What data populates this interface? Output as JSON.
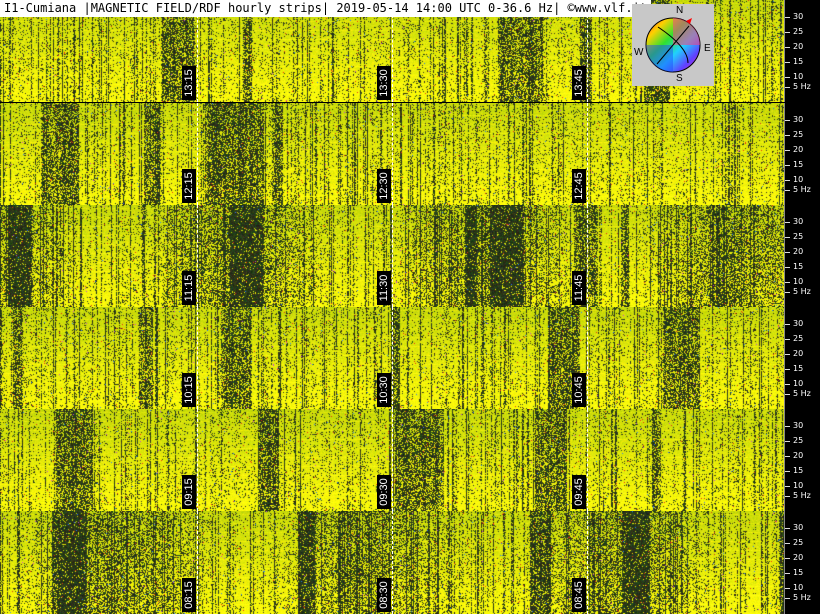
{
  "header": {
    "title": "I1-Cumiana |MAGNETIC FIELD/RDF hourly strips| 2019-05-14 14:00 UTC 0-36.6 Hz| ©www.vlf.it"
  },
  "compass": {
    "n": "N",
    "s": "S",
    "e": "E",
    "w": "W"
  },
  "axis_ticks": [
    "30",
    "25",
    "20",
    "15",
    "10",
    "5 Hz"
  ],
  "strips": [
    {
      "times": [
        "13:15",
        "13:30",
        "13:45"
      ]
    },
    {
      "times": [
        "12:15",
        "12:30",
        "12:45"
      ]
    },
    {
      "times": [
        "11:15",
        "11:30",
        "11:45"
      ]
    },
    {
      "times": [
        "10:15",
        "10:30",
        "10:45"
      ]
    },
    {
      "times": [
        "09:15",
        "09:30",
        "09:45"
      ]
    },
    {
      "times": [
        "08:15",
        "08:30",
        "08:45"
      ]
    }
  ]
}
